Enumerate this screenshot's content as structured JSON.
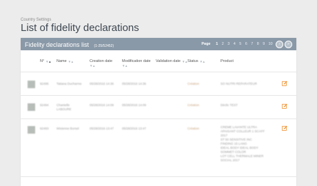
{
  "breadcrumb": "Country Settings",
  "title": "List of fidelity declarations",
  "panel": {
    "title": "Fidelity declarations list",
    "range": "(1-25/52452)"
  },
  "pager": {
    "label": "Page",
    "pages": [
      "1",
      "2",
      "3",
      "4",
      "5",
      "6",
      "7",
      "8",
      "9",
      "10"
    ],
    "current": "1",
    "next_icon": "chevron-right-icon",
    "last_icon": "double-chevron-right-icon"
  },
  "columns": [
    "N°",
    "Name",
    "Creation date",
    "Modification date",
    "Validation date",
    "Status",
    "Product"
  ],
  "rows": [
    {
      "number": "92495",
      "name": [
        "Tatiana Ducharme"
      ],
      "created": "05/28/2016 14:36",
      "modified": "05/28/2016 14:36",
      "validated": "",
      "status": "Création",
      "product": [
        "SO NUTRI REPARATEUR"
      ]
    },
    {
      "number": "92494",
      "name": [
        "Chantelle",
        "LABOURE"
      ],
      "created": "05/28/2016 14:09",
      "modified": "05/28/2016 14:09",
      "validated": "",
      "status": "Création",
      "product": [
        "Déclic TEST"
      ]
    },
    {
      "number": "92493",
      "name": [
        "Wivienne Borsel"
      ],
      "created": "05/28/2016 13:47",
      "modified": "05/28/2016 13:47",
      "validated": "",
      "status": "Création",
      "product": [
        "CREME LAVANTE ULTRA",
        "APAISANT COLLEUR 1 SCAFF",
        "2017",
        "ST 50 SENSITIVE INC",
        "FINDING 15 LANG",
        "IDEAL BODY IDEAL BODY",
        "SOMMET COLOR",
        "LOT CELL THERMALE MINER",
        "SOCIAL 2017"
      ]
    }
  ],
  "colors": {
    "header": "#8a99a8",
    "accent": "#f08a24",
    "background": "#ececec"
  }
}
